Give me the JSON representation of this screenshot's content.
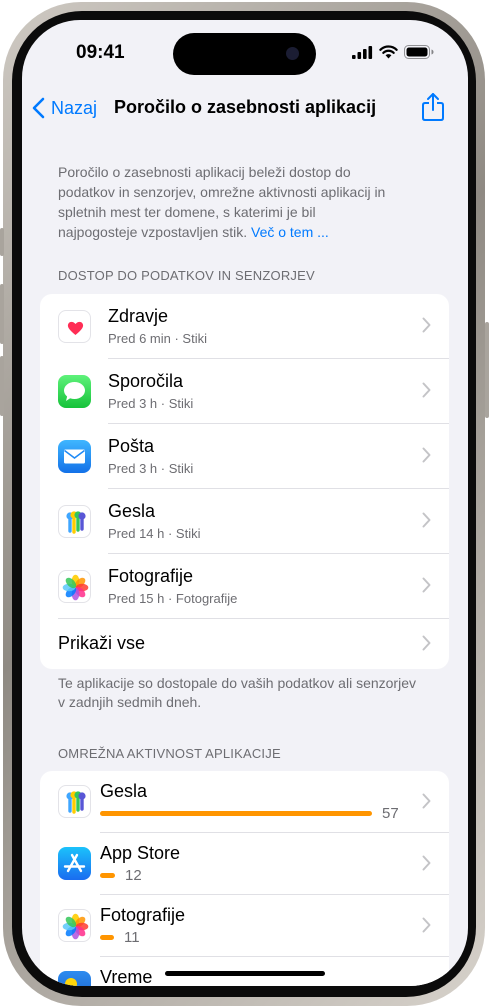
{
  "status_bar": {
    "time": "09:41"
  },
  "nav": {
    "back_label": "Nazaj",
    "title": "Poročilo o zasebnosti aplikacij"
  },
  "intro": {
    "text": "Poročilo o zasebnosti aplikacij beleži dostop do podatkov in senzorjev, omrežne aktivnosti aplikacij in spletnih mest ter domene, s katerimi je bil najpogosteje vzpostavljen stik.",
    "link": "Več o tem ..."
  },
  "data_access": {
    "header": "DOSTOP DO PODATKOV IN SENZORJEV",
    "items": [
      {
        "title": "Zdravje",
        "subtitle": "Pred 6 min · Stiki",
        "icon": "health-icon"
      },
      {
        "title": "Sporočila",
        "subtitle": "Pred 3 h · Stiki",
        "icon": "messages-icon"
      },
      {
        "title": "Pošta",
        "subtitle": "Pred 3 h · Stiki",
        "icon": "mail-icon"
      },
      {
        "title": "Gesla",
        "subtitle": "Pred 14 h · Stiki",
        "icon": "passwords-icon"
      },
      {
        "title": "Fotografije",
        "subtitle": "Pred 15 h · Fotografije",
        "icon": "photos-icon"
      }
    ],
    "show_all": "Prikaži vse",
    "footer": "Te aplikacije so dostopale do vaših podatkov ali senzorjev v zadnjih sedmih dneh."
  },
  "network": {
    "header": "OMREŽNA AKTIVNOST APLIKACIJE",
    "items": [
      {
        "title": "Gesla",
        "count": 57,
        "count_label": "57",
        "icon": "passwords-icon"
      },
      {
        "title": "App Store",
        "count": 12,
        "count_label": "12",
        "icon": "app-store-icon"
      },
      {
        "title": "Fotografije",
        "count": 11,
        "count_label": "11",
        "icon": "photos-icon"
      },
      {
        "title": "Vreme",
        "icon": "weather-icon"
      }
    ]
  },
  "colors": {
    "accent": "#007aff",
    "bar": "#ff9500",
    "background": "#f2f2f7"
  }
}
